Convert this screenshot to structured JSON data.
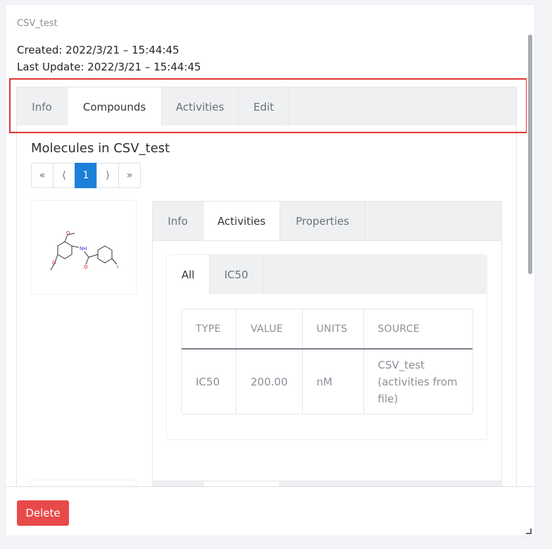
{
  "dataset": {
    "name": "CSV_test",
    "created": "Created: 2022/3/21 – 15:44:45",
    "updated": "Last Update: 2022/3/21 – 15:44:45"
  },
  "main_tabs": [
    {
      "label": "Info",
      "active": false
    },
    {
      "label": "Compounds",
      "active": true
    },
    {
      "label": "Activities",
      "active": false
    },
    {
      "label": "Edit",
      "active": false
    }
  ],
  "compounds": {
    "title": "Molecules in CSV_test",
    "pager": {
      "first": "«",
      "prev": "⟨",
      "current": "1",
      "next": "⟩",
      "last": "»"
    },
    "molecule_tabs": [
      {
        "label": "Info",
        "active": false
      },
      {
        "label": "Activities",
        "active": true
      },
      {
        "label": "Properties",
        "active": false
      }
    ],
    "activity_tabs": [
      {
        "label": "All",
        "active": true
      },
      {
        "label": "IC50",
        "active": false
      }
    ],
    "table": {
      "headers": [
        "TYPE",
        "VALUE",
        "UNITS",
        "SOURCE"
      ],
      "rows": [
        [
          "IC50",
          "200.00",
          "nM",
          "CSV_test (activities from file)"
        ]
      ]
    }
  },
  "footer": {
    "delete_label": "Delete"
  },
  "colors": {
    "primary": "#1c7fd8",
    "danger": "#e84a4a",
    "highlight": "#e03535"
  }
}
